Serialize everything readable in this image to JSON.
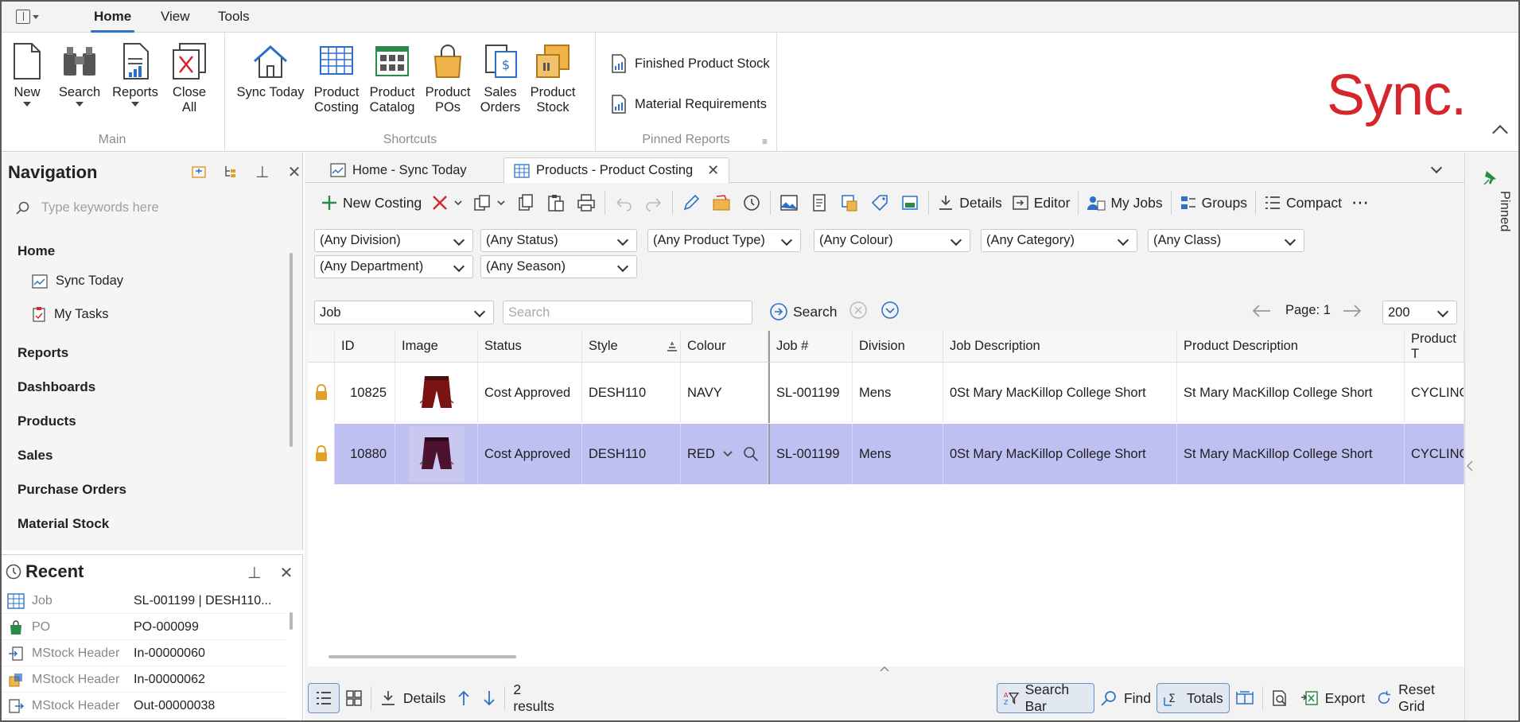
{
  "top_tabs": [
    "Home",
    "View",
    "Tools"
  ],
  "ribbon": {
    "main": {
      "label": "Main",
      "buttons": [
        {
          "line1": "New",
          "line2": ""
        },
        {
          "line1": "Search",
          "line2": ""
        },
        {
          "line1": "Reports",
          "line2": ""
        },
        {
          "line1": "Close",
          "line2": "All"
        }
      ]
    },
    "shortcuts": {
      "label": "Shortcuts",
      "buttons": [
        {
          "line1": "Sync Today",
          "line2": ""
        },
        {
          "line1": "Product",
          "line2": "Costing"
        },
        {
          "line1": "Product",
          "line2": "Catalog"
        },
        {
          "line1": "Product",
          "line2": "POs"
        },
        {
          "line1": "Sales",
          "line2": "Orders"
        },
        {
          "line1": "Product",
          "line2": "Stock"
        }
      ]
    },
    "pinned_reports": {
      "label": "Pinned Reports",
      "items": [
        "Finished Product Stock",
        "Material Requirements"
      ]
    },
    "logo": "Sync."
  },
  "navigation": {
    "title": "Navigation",
    "search_placeholder": "Type keywords here",
    "home": "Home",
    "home_items": [
      "Sync Today",
      "My Tasks"
    ],
    "sections": [
      "Reports",
      "Dashboards",
      "Products",
      "Sales",
      "Purchase Orders",
      "Material Stock"
    ]
  },
  "recent": {
    "title": "Recent",
    "rows": [
      {
        "type": "Job",
        "value": "SL-001199 | DESH110..."
      },
      {
        "type": "PO",
        "value": "PO-000099"
      },
      {
        "type": "MStock Header",
        "value": "In-00000060"
      },
      {
        "type": "MStock Header",
        "value": "In-00000062"
      },
      {
        "type": "MStock Header",
        "value": "Out-00000038"
      }
    ]
  },
  "doc_tabs": [
    "Home - Sync Today",
    "Products - Product Costing"
  ],
  "toolbar": {
    "new_costing": "New Costing",
    "details": "Details",
    "editor": "Editor",
    "my_jobs": "My Jobs",
    "groups": "Groups",
    "compact": "Compact"
  },
  "filters": {
    "division": "(Any Division)",
    "status": "(Any Status)",
    "product_type": "(Any Product Type)",
    "colour": "(Any Colour)",
    "category": "(Any Category)",
    "class": "(Any Class)",
    "department": "(Any Department)",
    "season": "(Any Season)"
  },
  "search": {
    "field": "Job",
    "placeholder": "Search",
    "button": "Search",
    "page": "Page: 1",
    "page_size": "200"
  },
  "grid": {
    "columns": [
      "ID",
      "Image",
      "Status",
      "Style",
      "Colour",
      "Job #",
      "Division",
      "Job Description",
      "Product Description",
      "Product T"
    ],
    "rows": [
      {
        "id": "10825",
        "status": "Cost Approved",
        "style": "DESH110",
        "colour": "NAVY",
        "job": "SL-001199",
        "division": "Mens",
        "job_desc": "0St Mary MacKillop College Short",
        "prod_desc": "St Mary MacKillop College Short",
        "prod_type": "CYCLING",
        "selected": false
      },
      {
        "id": "10880",
        "status": "Cost Approved",
        "style": "DESH110",
        "colour": "RED",
        "job": "SL-001199",
        "division": "Mens",
        "job_desc": "0St Mary MacKillop College Short",
        "prod_desc": "St Mary MacKillop College Short",
        "prod_type": "CYCLING",
        "selected": true
      }
    ]
  },
  "bottom": {
    "details": "Details",
    "results": "2 results",
    "search_bar": "Search Bar",
    "find": "Find",
    "totals": "Totals",
    "export": "Export",
    "reset_grid": "Reset Grid"
  },
  "pinned_strip": "Pinned",
  "colors": {
    "accent": "#2c70c9",
    "selected_row": "#bfc0f2",
    "logo": "#d6252b",
    "lock": "#e0a12a"
  }
}
